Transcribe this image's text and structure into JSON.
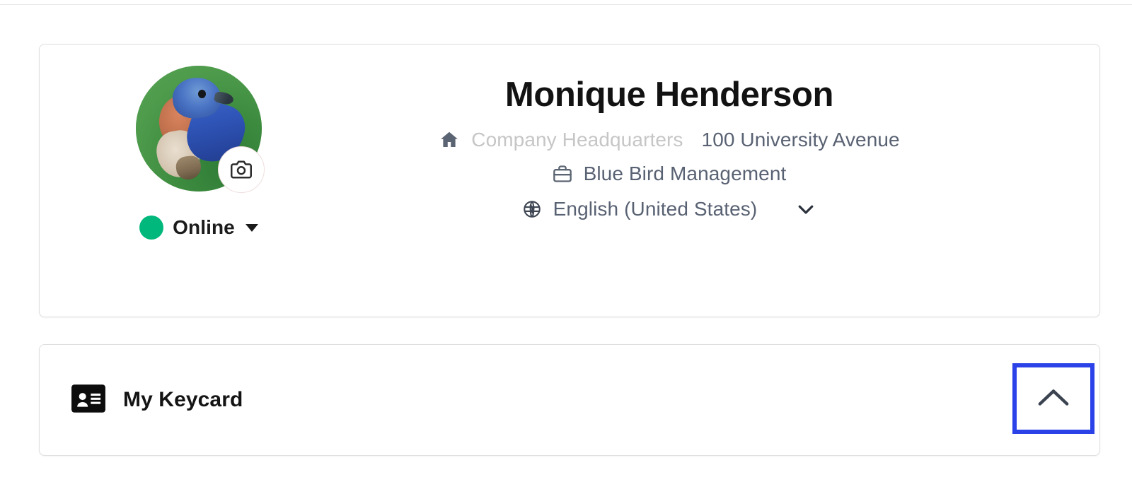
{
  "profile": {
    "avatar": {
      "icon": "user-avatar-bluebird-photo",
      "alt": "Bluebird profile photo"
    },
    "camera_button": {
      "icon": "camera-icon",
      "label": "Change profile photo"
    },
    "status": {
      "label": "Online",
      "color": "#00b87c",
      "chevron_icon": "caret-down-icon"
    },
    "name": "Monique Henderson",
    "address": {
      "icon": "home-icon",
      "label": "Company Headquarters",
      "value": "100 University Avenue"
    },
    "company": {
      "icon": "briefcase-icon",
      "value": "Blue Bird Management"
    },
    "language": {
      "icon": "globe-icon",
      "value": "English (United States)",
      "chevron_icon": "chevron-down-icon"
    }
  },
  "keycard": {
    "icon": "id-card-icon",
    "title": "My Keycard",
    "collapse_button": {
      "icon": "chevron-up-icon",
      "label": "Collapse My Keycard",
      "highlight_color": "#2a42e8"
    }
  }
}
